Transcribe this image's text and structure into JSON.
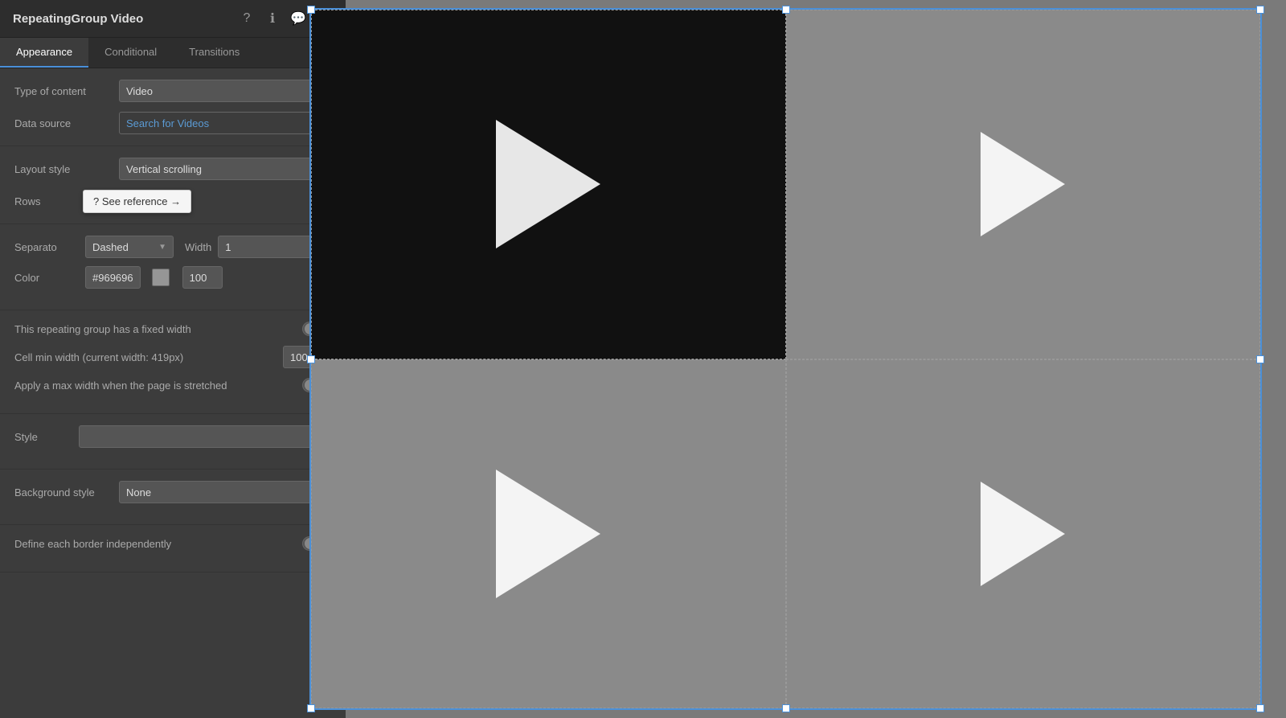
{
  "panel": {
    "title": "RepeatingGroup Video",
    "icons": {
      "help": "?",
      "info": "ℹ",
      "comment": "💬",
      "close": "✕"
    },
    "tabs": [
      {
        "label": "Appearance",
        "active": true
      },
      {
        "label": "Conditional",
        "active": false
      },
      {
        "label": "Transitions",
        "active": false
      }
    ],
    "type_of_content": {
      "label": "Type of content",
      "value": "Video"
    },
    "data_source": {
      "label": "Data source",
      "value": "Search for Videos"
    },
    "layout_style": {
      "label": "Layout style",
      "value": "Vertical scrolling"
    },
    "rows": {
      "label": "Rows",
      "value": "2"
    },
    "see_reference": {
      "label": "? See reference →"
    },
    "separator": {
      "label": "Separato",
      "style_value": "Dashed",
      "width_label": "Width",
      "width_value": "1"
    },
    "color": {
      "label": "Color",
      "hex": "#969696",
      "opacity": "100"
    },
    "fixed_width": {
      "label": "This repeating group has a fixed width"
    },
    "cell_min_width": {
      "label": "Cell min width (current width: 419px)",
      "value": "100"
    },
    "max_width": {
      "label": "Apply a max width when the page is stretched"
    },
    "style": {
      "label": "Style",
      "value": ""
    },
    "background_style": {
      "label": "Background style",
      "value": "None"
    },
    "define_border": {
      "label": "Define each border independently"
    }
  },
  "canvas": {
    "cells": [
      {
        "position": "top-left",
        "dark": true
      },
      {
        "position": "top-right",
        "dark": false
      },
      {
        "position": "bottom-left",
        "dark": false
      },
      {
        "position": "bottom-right",
        "dark": false
      }
    ]
  }
}
